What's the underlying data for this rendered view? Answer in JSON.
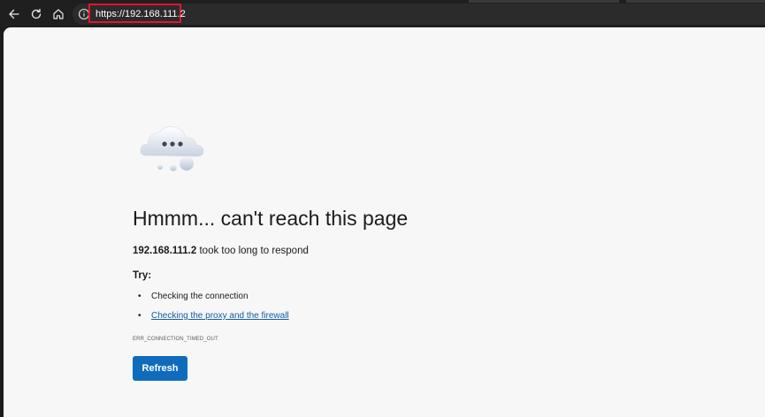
{
  "browser": {
    "url": "https://192.168.111.2",
    "icons": {
      "back": "back-arrow-icon",
      "refresh": "refresh-icon",
      "home": "home-icon",
      "site_info": "info-icon"
    },
    "highlight_color": "#e0162b"
  },
  "error_page": {
    "illustration": "cloud-icon",
    "headline": "Hmmm... can't reach this page",
    "host": "192.168.111.2",
    "message": " took too long to respond",
    "try_label": "Try:",
    "tips": [
      {
        "text": "Checking the connection",
        "link": false
      },
      {
        "text": "Checking the proxy and the firewall",
        "link": true
      }
    ],
    "error_code": "ERR_CONNECTION_TIMED_OUT",
    "refresh_label": "Refresh",
    "accent_color": "#0f6cbd",
    "link_color": "#115ea3"
  }
}
